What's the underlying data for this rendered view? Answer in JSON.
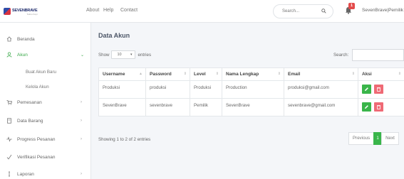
{
  "header": {
    "logo_text": "SEVENBRAVE",
    "logo_sub": "Tekno Kopi",
    "nav": [
      {
        "label": "About"
      },
      {
        "label": "Help"
      },
      {
        "label": "Contact"
      }
    ],
    "search_placeholder": "Search...",
    "notification_count": "1",
    "user_name": "SevenBrave|Pemilik"
  },
  "sidebar": {
    "items": [
      {
        "label": "Beranda",
        "icon": "home-icon"
      },
      {
        "label": "Akun",
        "icon": "user-icon",
        "active": true,
        "expanded": true,
        "children": [
          {
            "label": "Buat Akun Baru"
          },
          {
            "label": "Kelola Akun"
          }
        ]
      },
      {
        "label": "Pemesanan",
        "icon": "cart-icon"
      },
      {
        "label": "Data Barang",
        "icon": "document-icon"
      },
      {
        "label": "Progress Pesanan",
        "icon": "pulse-icon"
      },
      {
        "label": "Verifikasi Pesanan",
        "icon": "check-icon"
      },
      {
        "label": "Laporan",
        "icon": "report-icon"
      }
    ]
  },
  "main": {
    "title": "Data Akun",
    "show_label": "Show",
    "page_size": "10",
    "entries_label": "entries",
    "search_label": "Search:",
    "table": {
      "columns": [
        "Username",
        "Password",
        "Level",
        "Nama Lengkap",
        "Email",
        "Aksi"
      ],
      "rows": [
        [
          "Produksi",
          "produksi",
          "Produksi",
          "Production",
          "produksi@gmail.com"
        ],
        [
          "SevenBrave",
          "sevenbrave",
          "Pemilik",
          "SevenBrave",
          "sevenbrave@gmail.com"
        ]
      ]
    },
    "showing_text": "Showing 1 to 2 of 2 entries",
    "pagination": {
      "previous": "Previous",
      "current": "1",
      "next": "Next"
    }
  },
  "colors": {
    "accent": "#39b54a",
    "danger": "#ef6a75",
    "badge": "#e34b4b"
  }
}
